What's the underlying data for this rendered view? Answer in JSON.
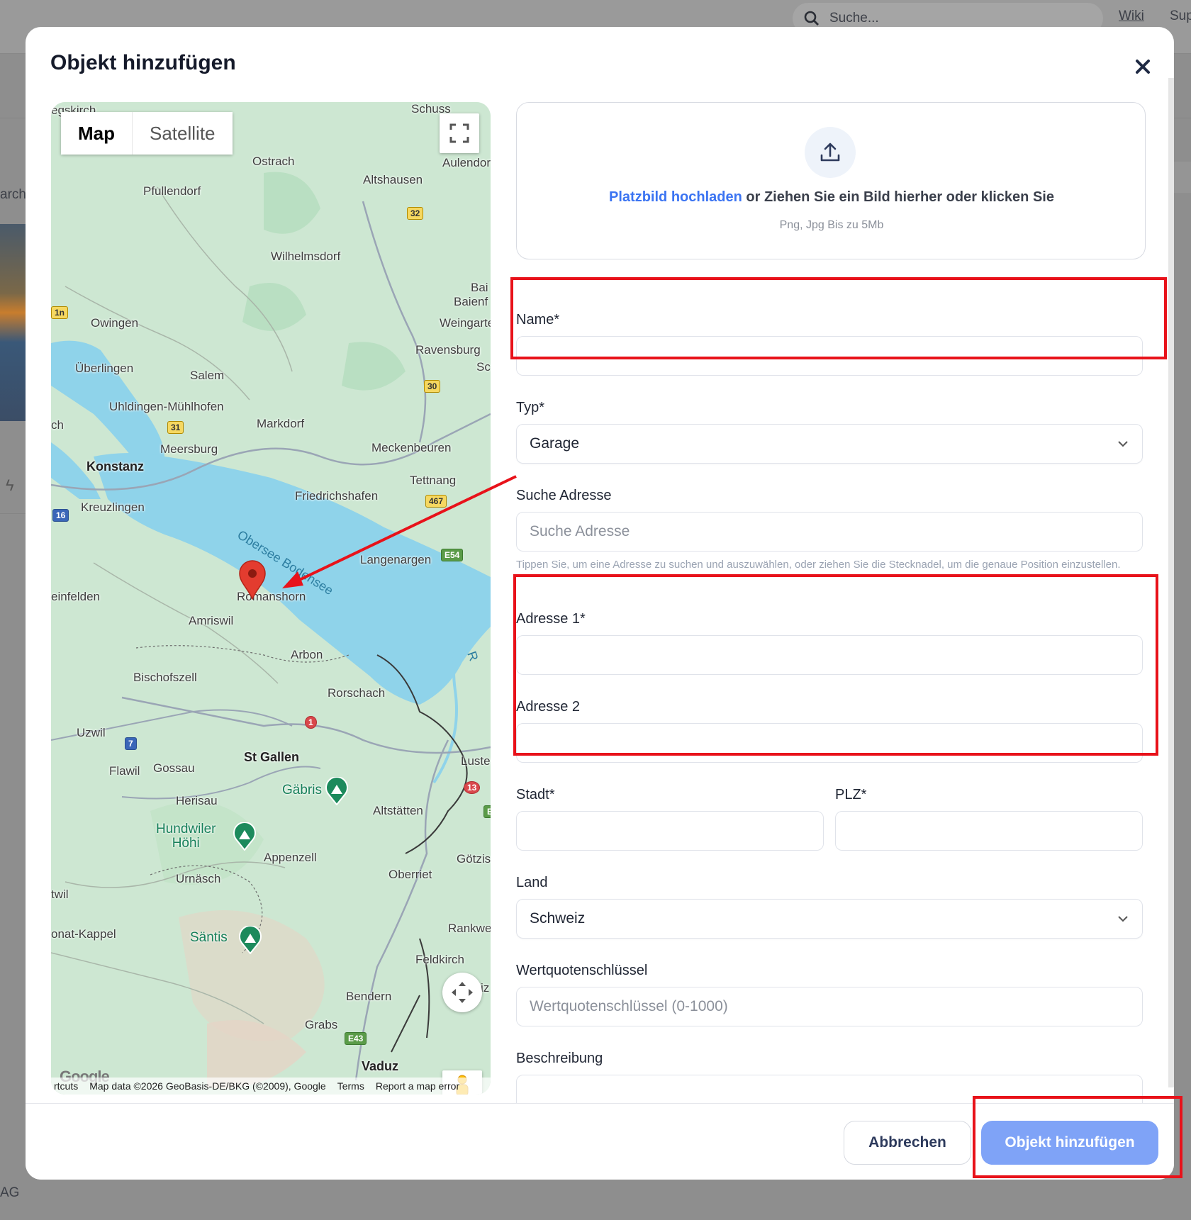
{
  "background": {
    "search_placeholder": "Suche...",
    "links": [
      "Wiki",
      "Sup"
    ],
    "left_fragments": [
      "arch",
      "AG"
    ]
  },
  "modal": {
    "title": "Objekt hinzufügen",
    "close_icon": "close-icon"
  },
  "map": {
    "type_options": [
      "Map",
      "Satellite"
    ],
    "selected_type": "Map",
    "places": {
      "konstanz": "Konstanz",
      "kreuzlingen": "Kreuzlingen",
      "ueberlingen": "Überlingen",
      "meersburg": "Meersburg",
      "friedrichshafen": "Friedrichshafen",
      "romanshorn": "Romanshorn",
      "arbon": "Arbon",
      "rorschach": "Rorschach",
      "st_gallen": "St Gallen",
      "altstaetten": "Altstätten",
      "appenzell": "Appenzell",
      "herisau": "Herisau",
      "gossau": "Gossau",
      "flawil": "Flawil",
      "uzwil": "Uzwil",
      "amriswil": "Amriswil",
      "bischofszell": "Bischofszell",
      "langenargen": "Langenargen",
      "tettnang": "Tettnang",
      "meckenbeuren": "Meckenbeuren",
      "markdorf": "Markdorf",
      "salem": "Salem",
      "uhldingen": "Uhldingen-Mühlhofen",
      "owingen": "Owingen",
      "pfullendorf": "Pfullendorf",
      "ostrach": "Ostrach",
      "altshausen": "Altshausen",
      "wilhelmsdorf": "Wilhelmsdorf",
      "ravensburg": "Ravensburg",
      "weingarten": "Weingarte",
      "baienfurt": "Baienf",
      "baindt": "Bai",
      "aulendorf": "Aulendor",
      "schussenried": "Schuss",
      "oberriet": "Oberriet",
      "urnaesch": "Urnäsch",
      "feldkirch": "Feldkirch",
      "bendern": "Bendern",
      "grabs": "Grabs",
      "vaduz": "Vaduz",
      "rankweil": "Rankwe",
      "goetzis": "Götzis",
      "lustenau": "Luste",
      "weinfelden": "einfelden",
      "wattwil": "twil",
      "nesslau": "onat-Kappel",
      "konstanz_left": "ch",
      "radolfzell": "egskirch",
      "sc": "Sc",
      "iz": "iz",
      "rh": "R"
    },
    "peaks": [
      "Gäbris",
      "Hundwiler\nHöhi",
      "Säntis"
    ],
    "lake_label": "Obersee Bodensee",
    "road_shields": [
      "32",
      "30",
      "31",
      "467",
      "16",
      "E54",
      "1",
      "7",
      "13",
      "E43",
      "E",
      "1n"
    ],
    "footer": {
      "shortcuts": "rtcuts",
      "attribution": "Map data ©2026 GeoBasis-DE/BKG (©2009), Google",
      "terms": "Terms",
      "report": "Report a map error"
    },
    "google_logo": "Google"
  },
  "upload": {
    "link_text": "Platzbild hochladen",
    "rest_text": " or Ziehen Sie ein Bild hierher oder klicken Sie",
    "hint": "Png, Jpg Bis zu 5Mb"
  },
  "form": {
    "name_label": "Name*",
    "name_value": "",
    "type_label": "Typ*",
    "type_value": "Garage",
    "search_label": "Suche Adresse",
    "search_placeholder": "Suche Adresse",
    "search_helper": "Tippen Sie, um eine Adresse zu suchen und auszuwählen, oder ziehen Sie die Stecknadel, um die genaue Position einzustellen.",
    "address1_label": "Adresse 1*",
    "address2_label": "Adresse 2",
    "city_label": "Stadt*",
    "zip_label": "PLZ*",
    "country_label": "Land",
    "country_value": "Schweiz",
    "quota_label": "Wertquotenschlüssel",
    "quota_placeholder": "Wertquotenschlüssel (0-1000)",
    "description_label": "Beschreibung"
  },
  "footer": {
    "cancel_label": "Abbrechen",
    "submit_label": "Objekt hinzufügen"
  },
  "colors": {
    "primary_button": "#7fa3f7",
    "link": "#3b74f2",
    "annotation": "#e8121a",
    "lake": "#8fd3ea",
    "land": "#cde7d2"
  }
}
